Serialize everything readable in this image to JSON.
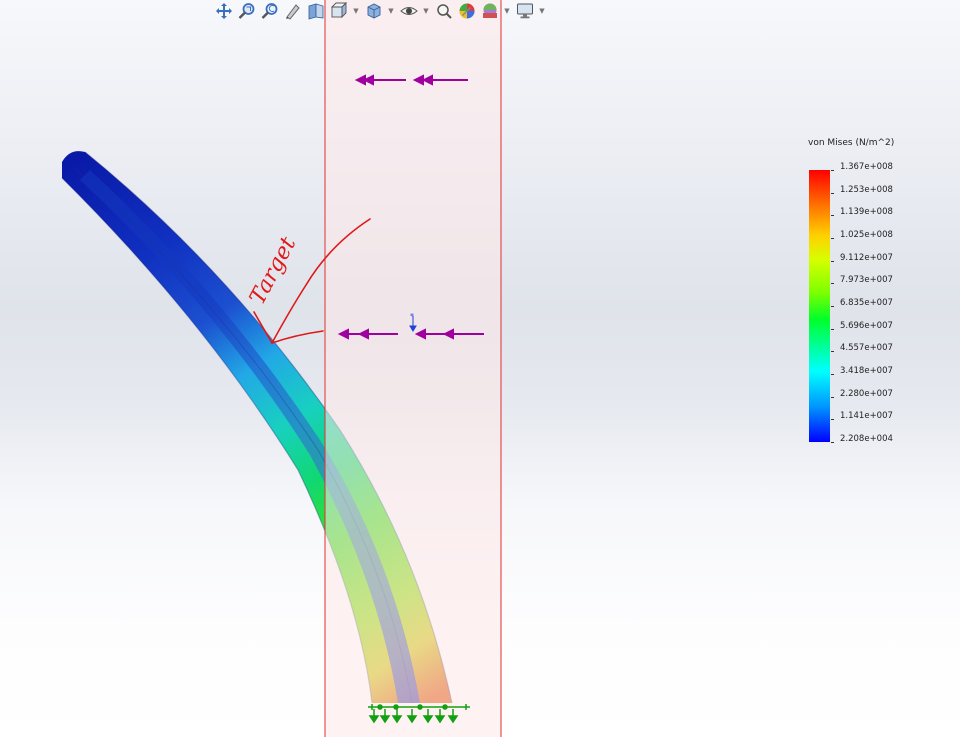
{
  "toolbar": {
    "buttons": [
      {
        "icon": "zoom-to-fit-icon"
      },
      {
        "icon": "zoom-to-area-icon"
      },
      {
        "icon": "previous-view-icon"
      },
      {
        "icon": "section-view-icon"
      },
      {
        "icon": "view-orientation-icon",
        "dropdown": true
      },
      {
        "icon": "display-style-icon",
        "dropdown": true
      },
      {
        "icon": "hide-show-items-icon",
        "dropdown": true
      },
      {
        "icon": "edit-appearance-icon"
      },
      {
        "icon": "apply-scene-icon",
        "dropdown": true
      },
      {
        "icon": "view-settings-icon",
        "dropdown": true
      }
    ]
  },
  "legend": {
    "title": "von Mises (N/m^2)",
    "values": [
      "1.367e+008",
      "1.253e+008",
      "1.139e+008",
      "1.025e+008",
      "9.112e+007",
      "7.973e+007",
      "6.835e+007",
      "5.696e+007",
      "4.557e+007",
      "3.418e+007",
      "2.280e+007",
      "1.141e+007",
      "2.208e+004"
    ],
    "colors": {
      "max": "#ff0000",
      "min": "#0000ff"
    }
  },
  "annotation": {
    "handwritten_label": "Target",
    "ink_color": "#e01818"
  },
  "loads": {
    "pressure_color": "#a000a0",
    "fixture_color": "#10a010"
  },
  "section_plane": {
    "border_color": "#e03030",
    "fill_color": "#fde7e7"
  }
}
